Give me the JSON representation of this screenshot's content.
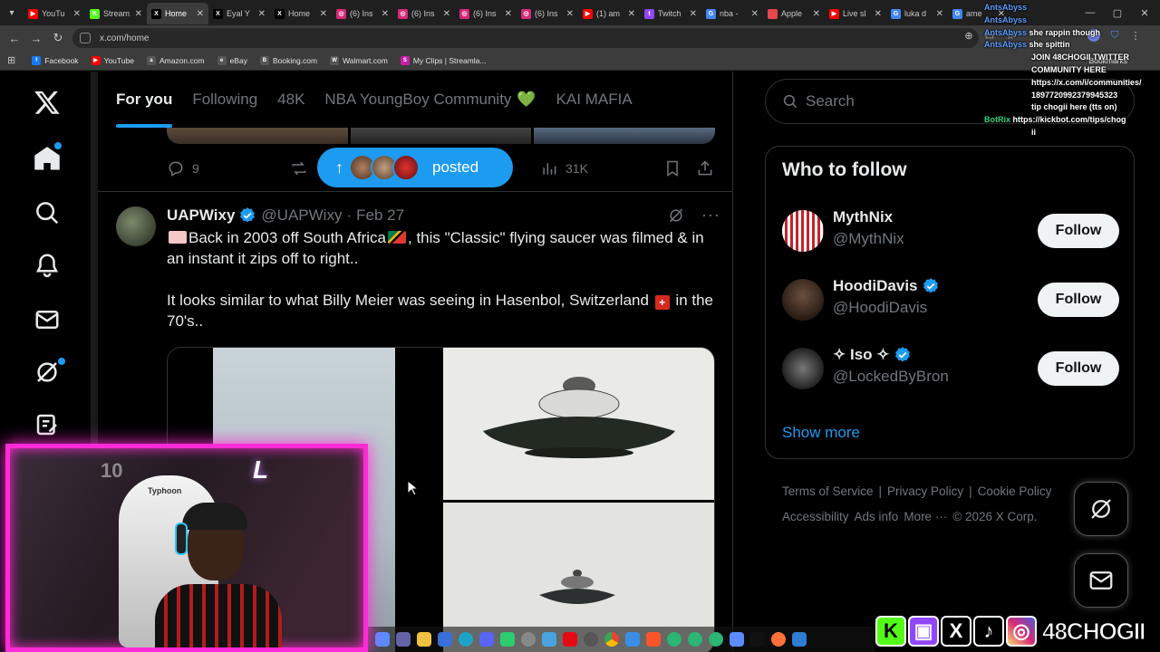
{
  "browser": {
    "tabs": [
      {
        "title": "YouTu",
        "fav_color": "#ff0000",
        "fav_glyph": "▶",
        "active": false
      },
      {
        "title": "Stream",
        "fav_color": "#53fc18",
        "fav_glyph": "K",
        "active": false
      },
      {
        "title": "Home",
        "fav_color": "#000000",
        "fav_glyph": "X",
        "active": true
      },
      {
        "title": "Eyal Y",
        "fav_color": "#000000",
        "fav_glyph": "X",
        "active": false
      },
      {
        "title": "Home",
        "fav_color": "#000000",
        "fav_glyph": "X",
        "active": false
      },
      {
        "title": "(6) Ins",
        "fav_color": "#d62976",
        "fav_glyph": "◎",
        "active": false
      },
      {
        "title": "(6) Ins",
        "fav_color": "#d62976",
        "fav_glyph": "◎",
        "active": false
      },
      {
        "title": "(6) Ins",
        "fav_color": "#d62976",
        "fav_glyph": "◎",
        "active": false
      },
      {
        "title": "(6) Ins",
        "fav_color": "#d62976",
        "fav_glyph": "◎",
        "active": false
      },
      {
        "title": "(1) am",
        "fav_color": "#ff0000",
        "fav_glyph": "▶",
        "active": false
      },
      {
        "title": "Twitch",
        "fav_color": "#9146ff",
        "fav_glyph": "t",
        "active": false
      },
      {
        "title": "nba -",
        "fav_color": "#4285f4",
        "fav_glyph": "G",
        "active": false
      },
      {
        "title": "Apple",
        "fav_color": "#e5484d",
        "fav_glyph": "",
        "active": false
      },
      {
        "title": "Live sl",
        "fav_color": "#ff0000",
        "fav_glyph": "▶",
        "active": false
      },
      {
        "title": "luka d",
        "fav_color": "#4285f4",
        "fav_glyph": "G",
        "active": false
      },
      {
        "title": "ame",
        "fav_color": "#4285f4",
        "fav_glyph": "G",
        "active": false
      }
    ],
    "url": "x.com/home",
    "bookmarks": [
      {
        "label": "Facebook",
        "color": "#1877f2",
        "glyph": "f"
      },
      {
        "label": "YouTube",
        "color": "#ff0000",
        "glyph": "▶"
      },
      {
        "label": "Amazon.com",
        "color": "#555555",
        "glyph": "a"
      },
      {
        "label": "eBay",
        "color": "#555555",
        "glyph": "e"
      },
      {
        "label": "Booking.com",
        "color": "#555555",
        "glyph": "B"
      },
      {
        "label": "Walmart.com",
        "color": "#555555",
        "glyph": "W"
      },
      {
        "label": "My Clips | Streamla...",
        "color": "#c51fa8",
        "glyph": "S"
      }
    ],
    "bookmarks_right": "Bookmarks"
  },
  "feed": {
    "tabs": [
      {
        "label": "For you",
        "active": true
      },
      {
        "label": "Following",
        "active": false
      },
      {
        "label": "48K",
        "active": false
      },
      {
        "label": "NBA YoungBoy Community",
        "active": false,
        "suffix": "💚"
      },
      {
        "label": "KAI MAFIA",
        "active": false
      }
    ],
    "prev_tweet": {
      "replies": "9",
      "views": "31K"
    },
    "new_posts_pill": {
      "label": "posted"
    },
    "tweet": {
      "name": "UAPWixy",
      "handle": "@UAPWixy",
      "separator": "·",
      "date": "Feb 27",
      "line1_prefix": "Back in 2003 off South Africa",
      "line1_suffix": ", this \"Classic\" flying saucer was filmed & in an instant it zips off to right..",
      "line2_prefix": "It looks similar to what Billy Meier was seeing in Hasenbol, Switzerland",
      "line2_suffix": " in the 70's.."
    }
  },
  "sidebar": {
    "search_placeholder": "Search",
    "who_to_follow": {
      "title": "Who to follow",
      "accounts": [
        {
          "name": "MythNix",
          "handle": "@MythNix",
          "verified": false,
          "button": "Follow"
        },
        {
          "name": "HoodiDavis",
          "handle": "@HoodiDavis",
          "verified": true,
          "button": "Follow"
        },
        {
          "name": "✧ Iso ✧",
          "handle": "@LockedByBron",
          "verified": true,
          "button": "Follow"
        }
      ],
      "show_more": "Show more"
    },
    "footer": {
      "row1": [
        "Terms of Service",
        "Privacy Policy",
        "Cookie Policy"
      ],
      "row2": [
        "Accessibility",
        "Ads info",
        "More ···",
        "© 2026 X Corp."
      ]
    }
  },
  "overlay": {
    "chat": [
      {
        "user": "AntsAbyss",
        "user_class": "u1",
        "msg": ""
      },
      {
        "user": "AntsAbyss",
        "user_class": "u1",
        "msg": ""
      },
      {
        "user": "AntsAbyss",
        "user_class": "u1",
        "msg": "she rappin though"
      },
      {
        "user": "AntsAbyss",
        "user_class": "u1",
        "msg": "she spittin"
      },
      {
        "user": "",
        "user_class": "u1",
        "msg": "JOIN 48CHOGII TWITTER"
      },
      {
        "user": "",
        "user_class": "u1",
        "msg": "COMMUNITY HERE"
      },
      {
        "user": "",
        "user_class": "u1",
        "msg": "https://x.com/i/communities/"
      },
      {
        "user": "",
        "user_class": "u1",
        "msg": "1897720992379945323"
      },
      {
        "user": "",
        "user_class": "u1",
        "msg": "tip chogii here (tts on)"
      },
      {
        "user": "BotRix",
        "user_class": "u2",
        "msg": "https://kickbot.com/tips/chog"
      },
      {
        "user": "",
        "user_class": "u1",
        "msg": "ii"
      }
    ],
    "brand": "48CHOGII",
    "webcam_chair_brand": "Typhoon",
    "webcam_jersey": "10"
  }
}
